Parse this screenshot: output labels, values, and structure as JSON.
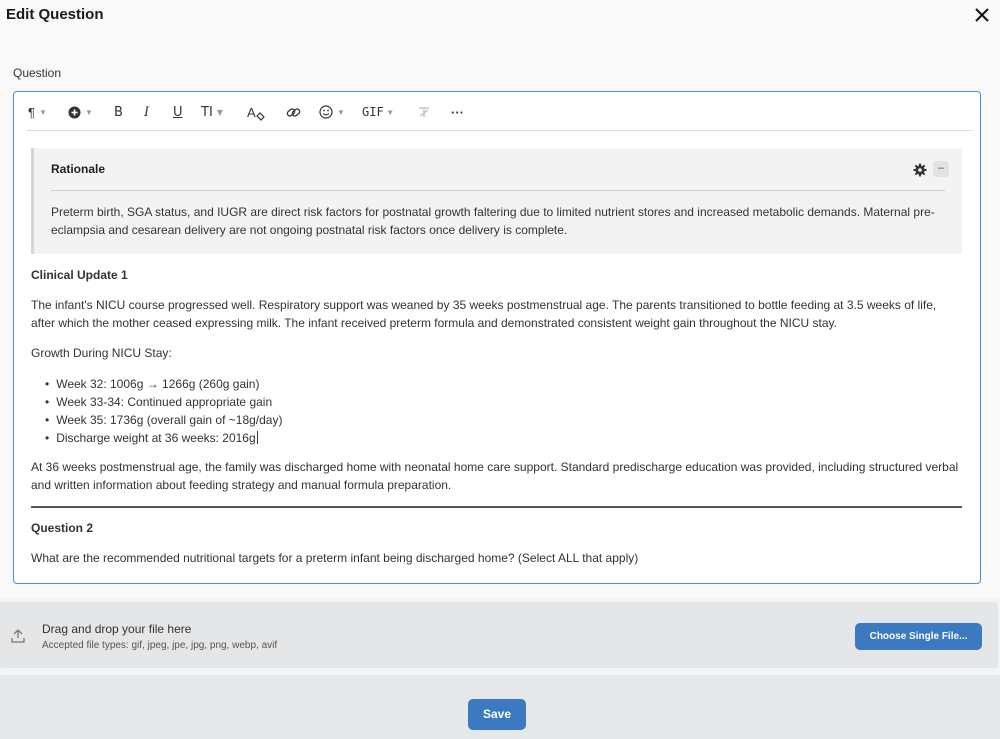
{
  "modal": {
    "title": "Edit Question"
  },
  "field": {
    "label": "Question"
  },
  "toolbar": {
    "paragraph_glyph": "¶",
    "bold": "B",
    "italic": "I",
    "underline": "U",
    "text_size": "TI",
    "text_color": "A",
    "gif": "GIF",
    "more": "···",
    "icons": [
      "paragraph-icon",
      "insert-icon",
      "bold-icon",
      "italic-icon",
      "underline-icon",
      "text-size-icon",
      "text-color-icon",
      "link-icon",
      "emoji-icon",
      "gif-icon",
      "clear-format-icon",
      "more-icon"
    ]
  },
  "rationale": {
    "title": "Rationale",
    "text": "Preterm birth, SGA status, and IUGR are direct risk factors for postnatal growth faltering due to limited nutrient stores and increased metabolic demands. Maternal pre-eclampsia and cesarean delivery are not ongoing postnatal risk factors once delivery is complete.",
    "collapse_glyph": "–"
  },
  "clinical_update": {
    "heading": "Clinical Update 1",
    "intro": "The infant's NICU course progressed well. Respiratory support was weaned by 35 weeks postmenstrual age. The parents transitioned to bottle feeding at 3.5 weeks of life, after which the mother ceased expressing milk. The infant received preterm formula and demonstrated consistent weight gain throughout the NICU stay.",
    "growth_label": "Growth During NICU Stay:",
    "bullets": [
      "Week 32: 1006g → 1266g (260g gain)",
      "Week 33-34: Continued appropriate gain",
      "Week 35: 1736g (overall gain of ~18g/day)",
      "Discharge weight at 36 weeks: 2016g"
    ],
    "discharge": "At 36 weeks postmenstrual age, the family was discharged home with neonatal home care support. Standard predischarge education was provided, including structured verbal and written information about feeding strategy and manual formula preparation."
  },
  "question": {
    "heading": "Question 2",
    "text": "What are the recommended nutritional targets for a preterm infant being discharged home? (Select ALL that apply)"
  },
  "upload": {
    "main": "Drag and drop your file here",
    "sub": "Accepted file types: gif, jpeg, jpe, jpg, png, webp, avif",
    "button": "Choose Single File..."
  },
  "footer": {
    "save": "Save"
  },
  "colors": {
    "accent": "#3b79c0",
    "editor_border": "#4a90c8"
  }
}
